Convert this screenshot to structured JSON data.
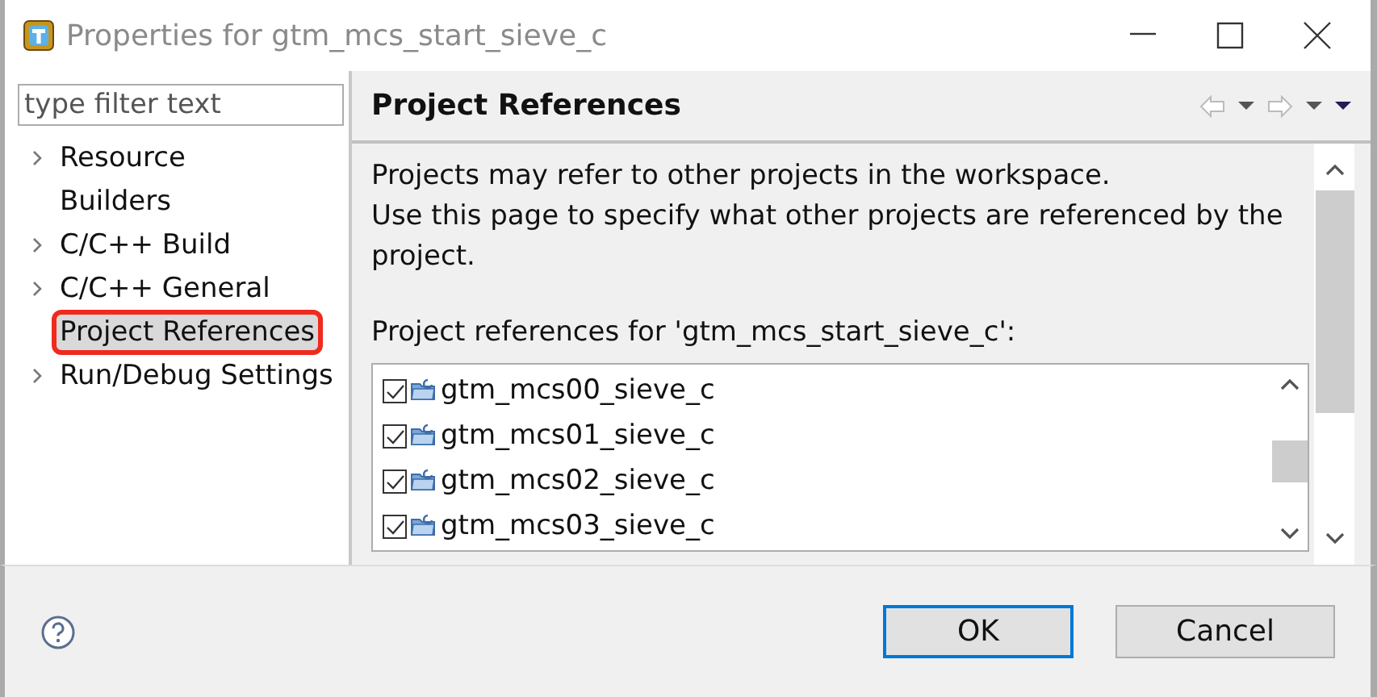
{
  "window": {
    "title": "Properties for gtm_mcs_start_sieve_c"
  },
  "filter": {
    "placeholder": "type filter text"
  },
  "tree": [
    {
      "label": "Resource",
      "expandable": true,
      "selected": false,
      "highlighted": false
    },
    {
      "label": "Builders",
      "expandable": false,
      "selected": false,
      "highlighted": false
    },
    {
      "label": "C/C++ Build",
      "expandable": true,
      "selected": false,
      "highlighted": false
    },
    {
      "label": "C/C++ General",
      "expandable": true,
      "selected": false,
      "highlighted": false
    },
    {
      "label": "Project References",
      "expandable": false,
      "selected": true,
      "highlighted": true
    },
    {
      "label": "Run/Debug Settings",
      "expandable": true,
      "selected": false,
      "highlighted": false
    }
  ],
  "page": {
    "title": "Project References",
    "description": [
      "Projects may refer to other projects in the workspace.",
      "Use this page to specify what other projects are referenced by the project."
    ],
    "list_label": "Project references for 'gtm_mcs_start_sieve_c':",
    "projects": [
      {
        "name": "gtm_mcs00_sieve_c",
        "checked": true
      },
      {
        "name": "gtm_mcs01_sieve_c",
        "checked": true
      },
      {
        "name": "gtm_mcs02_sieve_c",
        "checked": true
      },
      {
        "name": "gtm_mcs03_sieve_c",
        "checked": true
      }
    ]
  },
  "buttons": [
    {
      "label": "OK",
      "default": true
    },
    {
      "label": "Cancel",
      "default": false
    }
  ]
}
